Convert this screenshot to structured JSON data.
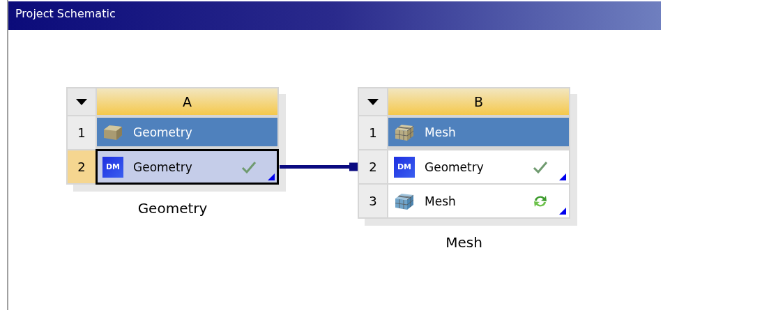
{
  "panel": {
    "title": "Project Schematic"
  },
  "systems": [
    {
      "column": "A",
      "caption": "Geometry",
      "cells": [
        {
          "number": "1",
          "label": "Geometry",
          "kind": "title",
          "up_to_date": false,
          "update_required": false,
          "selected": false,
          "linked_out": false,
          "linked_in": false
        },
        {
          "number": "2",
          "label": "Geometry",
          "kind": "component",
          "icon_label": "DM",
          "up_to_date": true,
          "update_required": false,
          "selected": true,
          "linked_out": true,
          "linked_in": false
        }
      ]
    },
    {
      "column": "B",
      "caption": "Mesh",
      "cells": [
        {
          "number": "1",
          "label": "Mesh",
          "kind": "title",
          "up_to_date": false,
          "update_required": false,
          "selected": false,
          "linked_out": false,
          "linked_in": false
        },
        {
          "number": "2",
          "label": "Geometry",
          "kind": "component",
          "icon_label": "DM",
          "up_to_date": true,
          "update_required": false,
          "selected": false,
          "linked_out": false,
          "linked_in": true
        },
        {
          "number": "3",
          "label": "Mesh",
          "kind": "component",
          "up_to_date": false,
          "update_required": true,
          "selected": false,
          "linked_out": false,
          "linked_in": false
        }
      ]
    }
  ]
}
